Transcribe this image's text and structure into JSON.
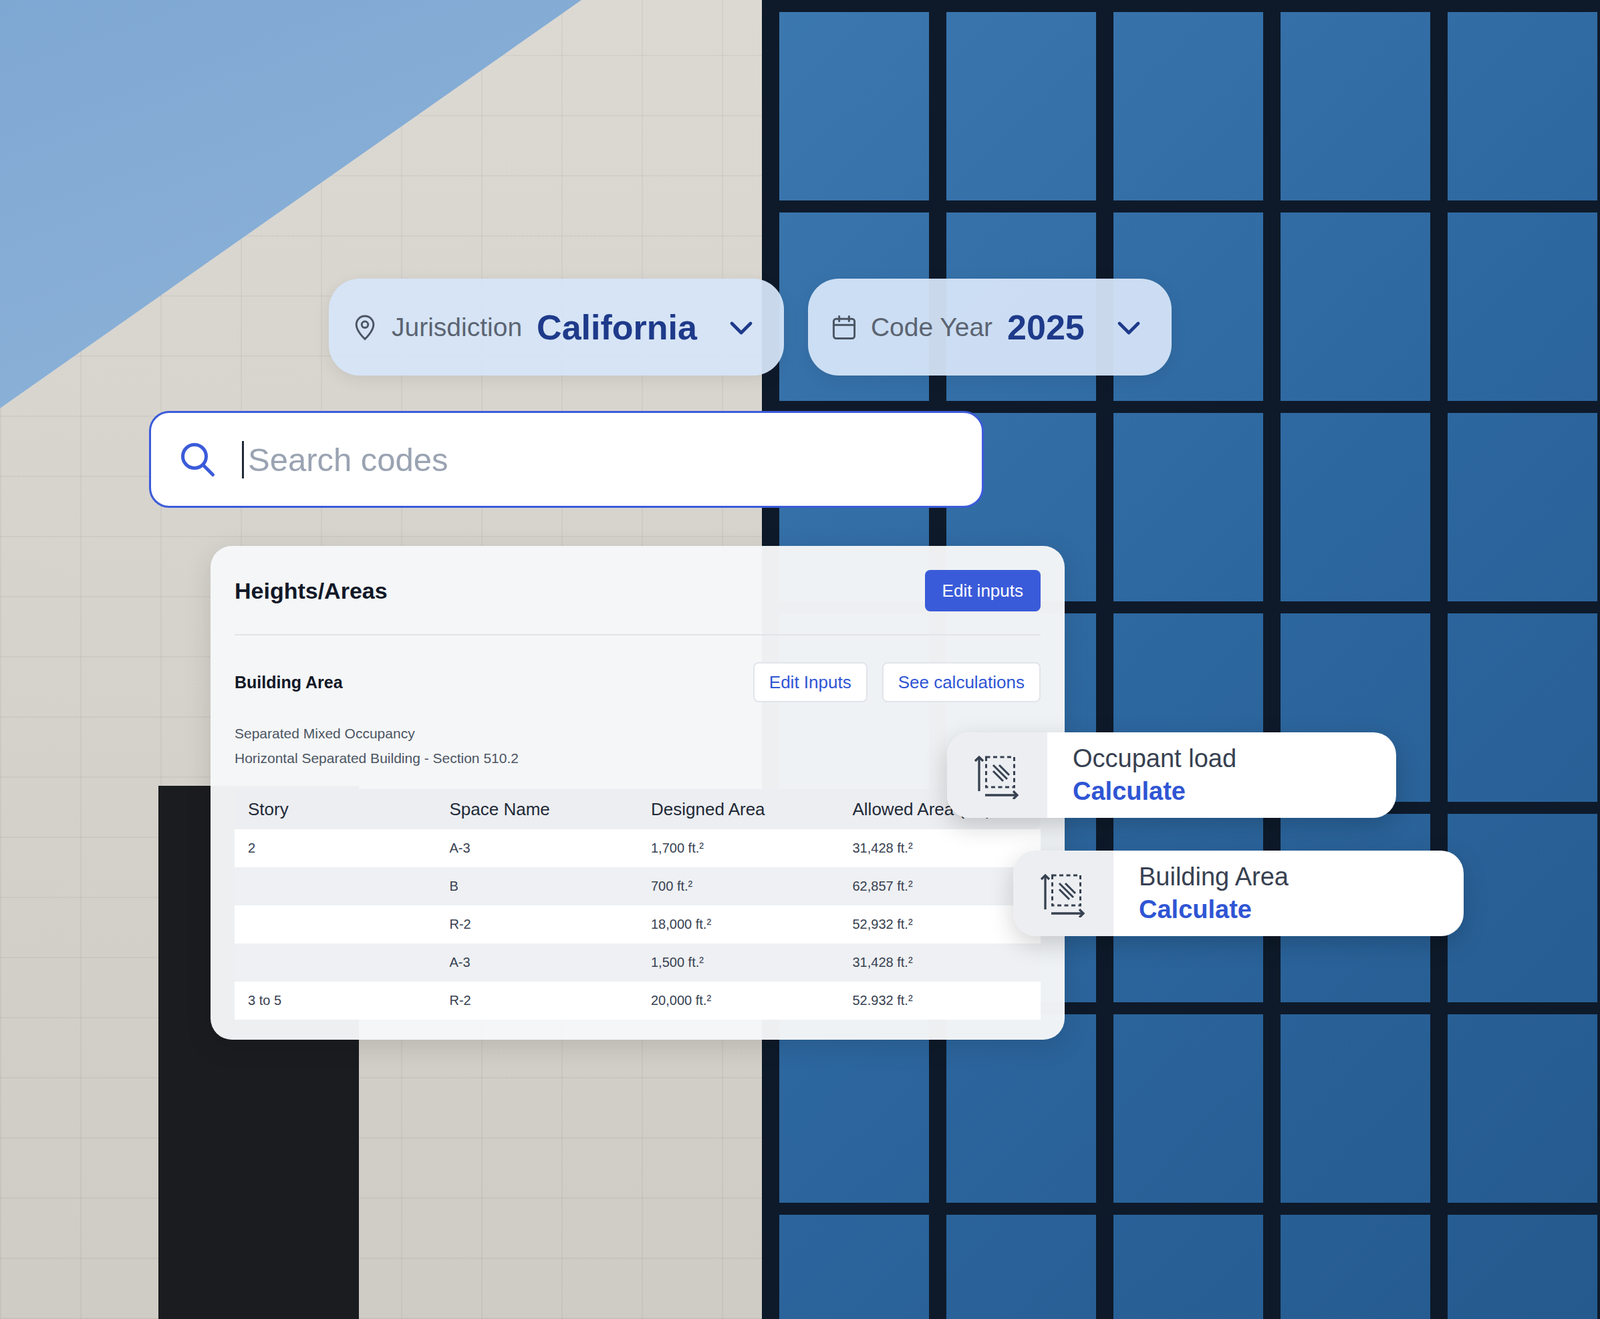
{
  "filters": [
    {
      "kind": "location",
      "label": "Jurisdiction",
      "value": "California"
    },
    {
      "kind": "date",
      "label": "Code Year",
      "value": "2025"
    }
  ],
  "search": {
    "placeholder": "Search codes",
    "focused": true
  },
  "panel": {
    "title": "Heights/Areas",
    "primary_button": "Edit inputs",
    "section": {
      "title": "Building Area",
      "buttons": [
        "Edit Inputs",
        "See calculations"
      ],
      "notes": [
        "Separated Mixed Occupancy",
        "Horizontal Separated Building - Section 510.2"
      ]
    },
    "table": {
      "columns": [
        "Story",
        "Space Name",
        "Designed Area",
        "Allowed Area (Aa)"
      ],
      "rows": [
        {
          "story": "2",
          "space": "A-3",
          "designed": "1,700 ft.²",
          "allowed": "31,428 ft.²"
        },
        {
          "story": "",
          "space": "B",
          "designed": "700 ft.²",
          "allowed": "62,857 ft.²"
        },
        {
          "story": "",
          "space": "R-2",
          "designed": "18,000 ft.²",
          "allowed": "52,932 ft.²"
        },
        {
          "story": "",
          "space": "A-3",
          "designed": "1,500 ft.²",
          "allowed": "31,428 ft.²"
        },
        {
          "story": "3 to 5",
          "space": "R-2",
          "designed": "20,000 ft.²",
          "allowed": "52.932 ft.²"
        }
      ]
    }
  },
  "calculators": [
    {
      "title": "Occupant load",
      "action": "Calculate"
    },
    {
      "title": "Building Area",
      "action": "Calculate"
    }
  ]
}
